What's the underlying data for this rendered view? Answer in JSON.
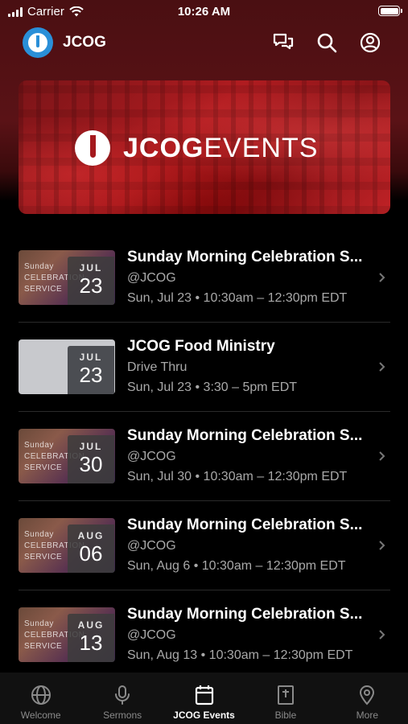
{
  "status_bar": {
    "carrier": "Carrier",
    "time": "10:26 AM"
  },
  "header": {
    "app_name": "JCOG"
  },
  "hero": {
    "brand_bold": "JCOG",
    "brand_light": "EVENTS"
  },
  "promo_text": [
    "Sunday",
    "CELEBRATION",
    "SERVICE"
  ],
  "events": [
    {
      "month": "JUL",
      "day": "23",
      "title": "Sunday Morning Celebration S...",
      "subtitle": "@JCOG",
      "time": "Sun, Jul 23 • 10:30am – 12:30pm EDT"
    },
    {
      "month": "JUL",
      "day": "23",
      "title": "JCOG Food Ministry",
      "subtitle": "Drive Thru",
      "time": "Sun, Jul 23 • 3:30 – 5pm EDT"
    },
    {
      "month": "JUL",
      "day": "30",
      "title": "Sunday Morning Celebration S...",
      "subtitle": "@JCOG",
      "time": "Sun, Jul 30 • 10:30am – 12:30pm EDT"
    },
    {
      "month": "AUG",
      "day": "06",
      "title": "Sunday Morning Celebration S...",
      "subtitle": "@JCOG",
      "time": "Sun, Aug 6 • 10:30am – 12:30pm EDT"
    },
    {
      "month": "AUG",
      "day": "13",
      "title": "Sunday Morning Celebration S...",
      "subtitle": "@JCOG",
      "time": "Sun, Aug 13 • 10:30am – 12:30pm EDT"
    }
  ],
  "tabs": [
    {
      "label": "Welcome",
      "icon": "globe-icon"
    },
    {
      "label": "Sermons",
      "icon": "microphone-icon"
    },
    {
      "label": "JCOG Events",
      "icon": "calendar-icon",
      "active": true
    },
    {
      "label": "Bible",
      "icon": "bible-icon"
    },
    {
      "label": "More",
      "icon": "location-pin-icon"
    }
  ],
  "colors": {
    "accent_red": "#a4191d",
    "logo_blue": "#2a8fd8",
    "muted_text": "#a9a9a9"
  }
}
